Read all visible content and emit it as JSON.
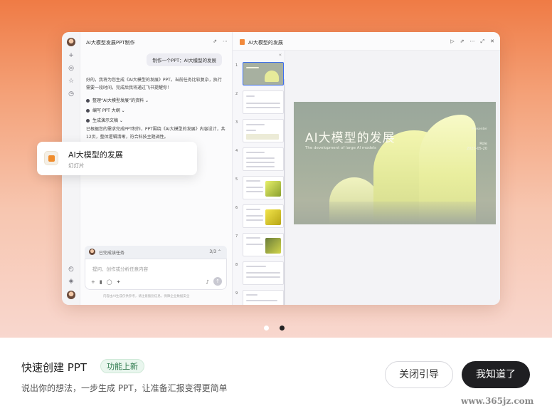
{
  "chat": {
    "title": "AI大模型发展PPT制作",
    "user_message": "制作一个PPT：AI大模型的发展",
    "reply_intro": "好的，我将为您生成《AI大模型的发展》PPT。当前任务比较复杂，执行需要一段时间，完成后我将通过飞书提醒你！",
    "steps": [
      "整理“AI大模型发展”的资料",
      "编写 PPT 大纲",
      "生成演示文稿"
    ],
    "reply_done": "已根据您的需求完成PPT制作，PPT围绕《AI大模型的发展》内容设计，共12页，整体逻辑清晰，符合科技主题调性。",
    "task_status": "已完成该任务",
    "task_count": "3/3",
    "input_placeholder": "提问、创作或分析任意内容",
    "disclaimer": "内容由AI生成仅供参考，请注意甄别信息，保障企业数据安全"
  },
  "ppt": {
    "file_title": "AI大模型的发展",
    "slide_numbers": [
      "1",
      "2",
      "3",
      "4",
      "5",
      "6",
      "7",
      "8",
      "9"
    ],
    "cover": {
      "title": "AI大模型的发展",
      "subtitle": "The development of large AI models",
      "presenter": "Presenter",
      "role": "Role",
      "date": "2025-05-20"
    }
  },
  "float_card": {
    "title": "AI大模型的发展",
    "subtitle": "幻灯片"
  },
  "pager": {
    "count": 2,
    "active_index": 1
  },
  "bottom": {
    "title": "快速创建 PPT",
    "badge": "功能上新",
    "description": "说出你的想法，一步生成 PPT，让准备汇报变得更简单",
    "close_label": "关闭引导",
    "ok_label": "我知道了"
  },
  "watermark": "www.365jz.com",
  "colors": {
    "accent_dark": "#1f1f22",
    "badge_green": "#2f7a4e",
    "hero_orange": "#ef7b45",
    "selection_blue": "#3a6df0"
  }
}
